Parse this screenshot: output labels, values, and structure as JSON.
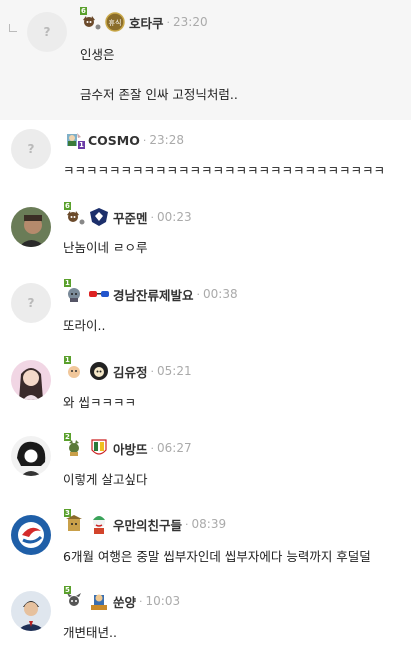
{
  "comments": [
    {
      "nick": "호타쿠",
      "time": "23:20",
      "lines": [
        "인생은",
        "금수저 존잘 인싸 고정닉처럼.."
      ],
      "level": "6",
      "emblem_label": "휴식",
      "avatar_placeholder": "?"
    },
    {
      "nick": "COSMO",
      "time": "23:28",
      "lines": [
        "ㅋㅋㅋㅋㅋㅋㅋㅋㅋㅋㅋㅋㅋㅋㅋㅋㅋㅋㅋㅋㅋㅋㅋㅋㅋㅋㅋㅋ"
      ],
      "level": "1",
      "avatar_placeholder": "?"
    },
    {
      "nick": "꾸준멘",
      "time": "00:23",
      "lines": [
        "난놈이네 ㄹㅇ루"
      ],
      "level": "6"
    },
    {
      "nick": "경남잔류제발요",
      "time": "00:38",
      "lines": [
        "또라이.."
      ],
      "level": "1",
      "avatar_placeholder": "?"
    },
    {
      "nick": "김유정",
      "time": "05:21",
      "lines": [
        "와 씹ㅋㅋㅋㅋ"
      ],
      "level": "1"
    },
    {
      "nick": "아방뜨",
      "time": "06:27",
      "lines": [
        "이렇게 살고싶다"
      ],
      "level": "2"
    },
    {
      "nick": "우만의친구들",
      "time": "08:39",
      "lines": [
        "6개월 여행은 중말 씹부자인데 씹부자에다 능력까지 후덜덜"
      ],
      "level": "3"
    },
    {
      "nick": "쑨양",
      "time": "10:03",
      "lines": [
        "개변태년.."
      ],
      "level": "5"
    }
  ],
  "colors": {
    "reply_bg": "#f6f6f6",
    "level_green": "#5aa02c",
    "level_purple": "#6a3aa6",
    "meta_gray": "#aaaaaa"
  }
}
